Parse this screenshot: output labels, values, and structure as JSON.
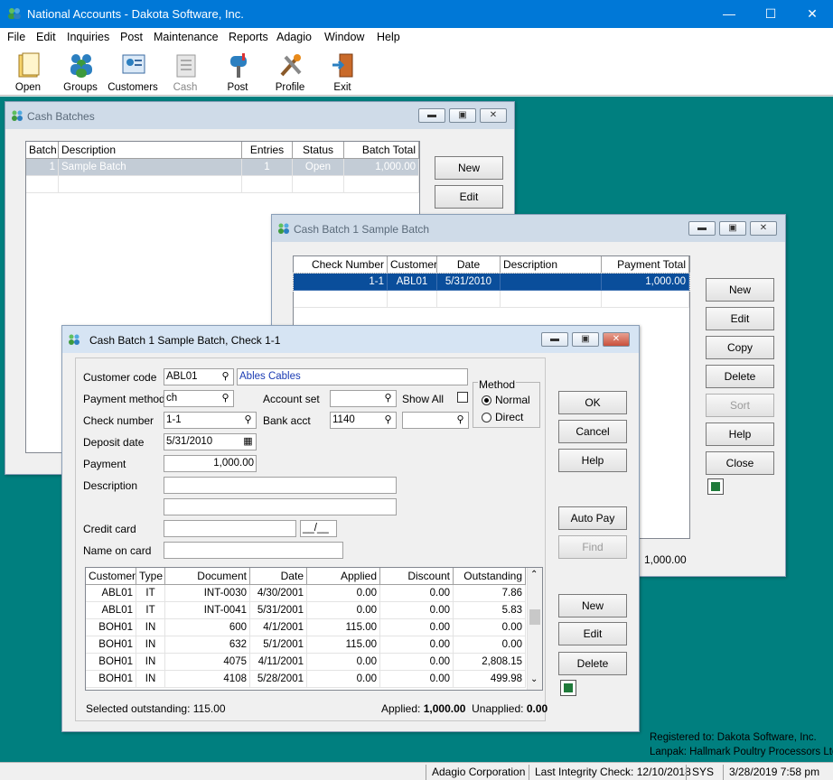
{
  "app": {
    "title": "National Accounts - Dakota Software, Inc."
  },
  "menu": [
    "File",
    "Edit",
    "Inquiries",
    "Post",
    "Maintenance",
    "Reports",
    "Adagio",
    "Window",
    "Help"
  ],
  "toolbar": [
    {
      "label": "Open",
      "icon": "folder-icon",
      "enabled": true
    },
    {
      "label": "Groups",
      "icon": "groups-icon",
      "enabled": true
    },
    {
      "label": "Customers",
      "icon": "customers-icon",
      "enabled": true
    },
    {
      "label": "Cash",
      "icon": "cash-icon",
      "enabled": false
    },
    {
      "label": "Post",
      "icon": "mailbox-icon",
      "enabled": true
    },
    {
      "label": "Profile",
      "icon": "tools-icon",
      "enabled": true
    },
    {
      "label": "Exit",
      "icon": "exit-door-icon",
      "enabled": true
    }
  ],
  "batches_window": {
    "title": "Cash Batches",
    "columns": [
      "Batch",
      "Description",
      "Entries",
      "Status",
      "Batch Total"
    ],
    "rows": [
      [
        "1",
        "Sample Batch",
        "1",
        "Open",
        "1,000.00"
      ]
    ],
    "buttons": {
      "new": "New",
      "edit": "Edit"
    }
  },
  "batch_window": {
    "title": "Cash Batch 1 Sample Batch",
    "columns": [
      "Check Number",
      "Customer",
      "Date",
      "Description",
      "Payment Total"
    ],
    "rows": [
      [
        "1-1",
        "ABL01",
        "5/31/2010",
        "",
        "1,000.00"
      ]
    ],
    "buttons": {
      "new": "New",
      "edit": "Edit",
      "copy": "Copy",
      "delete": "Delete",
      "sort": "Sort",
      "help": "Help",
      "close": "Close"
    },
    "total": "1,000.00"
  },
  "check_window": {
    "title": "Cash Batch 1 Sample Batch,  Check 1-1",
    "labels": {
      "customer_code": "Customer code",
      "payment_method": "Payment method",
      "check_number": "Check number",
      "deposit_date": "Deposit date",
      "payment": "Payment",
      "description": "Description",
      "credit_card": "Credit card",
      "name_on_card": "Name on card",
      "account_set": "Account set",
      "show_all": "Show All",
      "bank_acct": "Bank acct",
      "method": "Method",
      "normal": "Normal",
      "direct": "Direct"
    },
    "values": {
      "customer_code": "ABL01",
      "customer_name": "Ables Cables",
      "payment_method": "ch",
      "check_number": "1-1",
      "deposit_date": "5/31/2010",
      "payment": "1,000.00",
      "bank_acct": "1140",
      "card_exp": "__/__"
    },
    "method_selected": "Normal",
    "buttons": {
      "ok": "OK",
      "cancel": "Cancel",
      "help": "Help",
      "auto_pay": "Auto Pay",
      "find": "Find",
      "new": "New",
      "edit": "Edit",
      "delete": "Delete"
    },
    "doc_columns": [
      "Customer",
      "Type",
      "Document",
      "Date",
      "Applied",
      "Discount",
      "Outstanding"
    ],
    "doc_rows": [
      [
        "ABL01",
        "IT",
        "INT-0030",
        "4/30/2001",
        "0.00",
        "0.00",
        "7.86"
      ],
      [
        "ABL01",
        "IT",
        "INT-0041",
        "5/31/2001",
        "0.00",
        "0.00",
        "5.83"
      ],
      [
        "BOH01",
        "IN",
        "600",
        "4/1/2001",
        "115.00",
        "0.00",
        "0.00"
      ],
      [
        "BOH01",
        "IN",
        "632",
        "5/1/2001",
        "115.00",
        "0.00",
        "0.00"
      ],
      [
        "BOH01",
        "IN",
        "4075",
        "4/11/2001",
        "0.00",
        "0.00",
        "2,808.15"
      ],
      [
        "BOH01",
        "IN",
        "4108",
        "5/28/2001",
        "0.00",
        "0.00",
        "499.98"
      ]
    ],
    "footer": {
      "selected_outstanding_label": "Selected outstanding:",
      "selected_outstanding": "115.00",
      "applied_label": "Applied:",
      "applied": "1,000.00",
      "unapplied_label": "Unapplied:",
      "unapplied": "0.00"
    }
  },
  "registration": {
    "line1": "Registered to: Dakota Software, Inc.",
    "line2": "Lanpak: Hallmark Poultry Processors Ltd."
  },
  "status": {
    "company": "Adagio Corporation",
    "integrity": "Last Integrity Check: 12/10/2018",
    "user": "SYS",
    "datetime": "3/28/2019  7:58 pm"
  },
  "colors": {
    "titlebar": "#0078d7",
    "desktop": "#007f7f",
    "selection": "#0a4e9b",
    "link_text": "#1a3bb3"
  }
}
